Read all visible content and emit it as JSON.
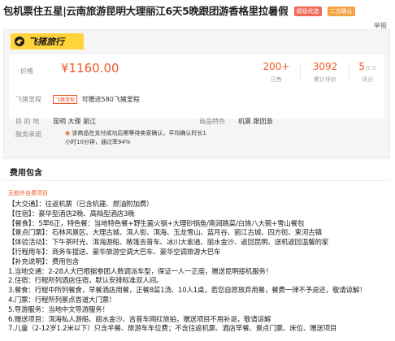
{
  "page": {
    "title": "包机票住五星|云南旅游昆明大理丽江6天5晚跟团游香格里拉暑假",
    "tags": [
      "超级优选",
      "二次确认"
    ],
    "report": "举报"
  },
  "brand": {
    "name": "飞猪旅行",
    "logo_icon": "fliggy-logo-icon"
  },
  "price": {
    "label": "价格",
    "currency": "¥",
    "value": "1160.00",
    "stats": [
      {
        "value": "200+",
        "suffix": "",
        "label": "已售"
      },
      {
        "value": "3092",
        "suffix": "",
        "label": "累计评价"
      },
      {
        "value": "5",
        "suffix": "/5.0",
        "label": "评分"
      }
    ]
  },
  "mileage": {
    "label": "飞猪里程",
    "tag": "飞猪里程",
    "text": "可赠送580飞猪里程"
  },
  "destination": {
    "label": "目 的 地",
    "value": "昆明  大理  丽江"
  },
  "feature": {
    "label": "商品特色",
    "value": "机票  跟团游"
  },
  "service": {
    "label": "服务承诺",
    "text": "该商品在支付成功后需等待卖家确认，平均确认时长1小时10分钟，通过率94%"
  },
  "fees": {
    "title": "费用包含",
    "note": "无额外自费项目",
    "lines": [
      "【大交通】：往返机票（已含机建、燃油附加费）",
      "【住宿】：豪华型酒店2晚、高档型酒店3晚",
      "【餐食】：5早6正，特色餐：当地特色餐+野生菌火锅+大理砂锅鱼/南涧跳菜/白族八大碗+雪山餐包",
      "【景点门票】：石林风景区、大理古城、洱人街、洱海、玉龙雪山、蓝月谷、丽江古城、四方街、束河古镇",
      "【体验活动】：下午茶时光、洱海游船、敞篷吉普车、冰川大索道、丽水金沙、返回昆明、送机返回温馨的家",
      "【行程用车】：商务车接送、豪华旅游空调大巴车、豪华空调旅游大巴车",
      "【补充说明】：费用包含",
      "1.当地交通：2-28人大巴根据参团人数调派车型，保证一人一正座，赠送昆明接机服务！",
      "2.住宿：行程所列酒店住宿，默认安排标准双人间。",
      "3.餐食：行程中所列餐食，早餐酒店用餐，正餐8菜1汤、10人1桌，若您自愿放弃用餐，餐费一律不予退还，敬请谅解！",
      "4.门票：行程所列景点首道大门票！",
      "5.导游服务：当地中文导游服务！",
      "6.赠送项目：洱海私人游船、丽水金沙、吉普车网红旅拍，赠送项目不用补退，敬请谅解",
      "7.儿童（2-12岁1.2米以下）只含半餐、旅游车车位费；不含往返机票、酒店早餐、景点门票、床位、赠送项目"
    ]
  },
  "colors": {
    "accent": "#f05a28",
    "brand_yellow": "#ffd43b",
    "tag_red": "#f06a5a",
    "tag_orange": "#f5a445"
  }
}
